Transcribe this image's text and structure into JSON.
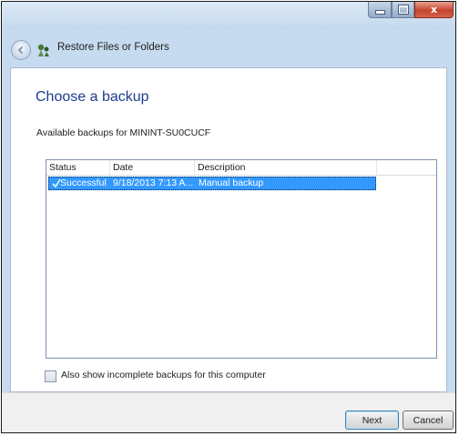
{
  "window": {
    "title": "Restore Files or Folders",
    "close_glyph": "x"
  },
  "page": {
    "heading": "Choose a backup",
    "subtitle": "Available backups for MININT-SU0CUCF"
  },
  "backups_table": {
    "columns": [
      "Status",
      "Date",
      "Description"
    ],
    "rows": [
      {
        "status": "Successful",
        "date": "9/18/2013 7:13 A...",
        "description": "Manual backup",
        "selected": true
      }
    ]
  },
  "options": {
    "show_incomplete_label": "Also show incomplete backups for this computer",
    "show_incomplete_checked": false
  },
  "buttons": {
    "next_label": "Next",
    "cancel_label": "Cancel"
  },
  "colors": {
    "heading": "#1e3d8f",
    "selection": "#3399ff",
    "frame": "#c6dbef",
    "close_button": "#c7442b"
  },
  "icons": {
    "back": "back-arrow-icon",
    "wizard": "restore-wizard-icon",
    "status": "checkmark-icon"
  }
}
